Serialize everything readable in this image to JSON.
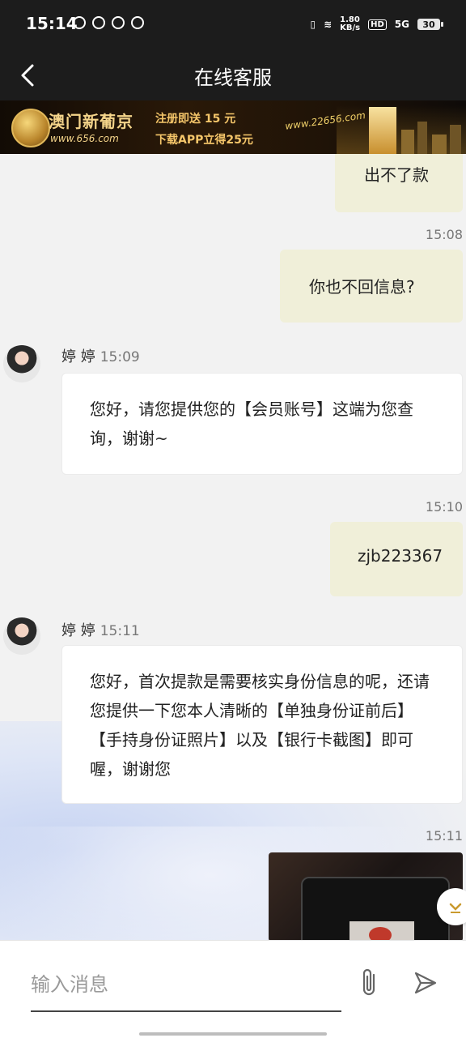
{
  "status_bar": {
    "time": "15:14",
    "network_speed": "1.80\nKB/s",
    "hd": "HD",
    "signal": "5G",
    "battery": "30"
  },
  "header": {
    "title": "在线客服"
  },
  "banner": {
    "brand": "澳门新葡京",
    "site": "www.656.com",
    "promo1": "注册即送 15 元",
    "promo2": "下载APP立得25元",
    "url": "www.22656.com"
  },
  "messages": [
    {
      "side": "right",
      "text": "出不了款",
      "time": ""
    },
    {
      "side": "right",
      "text": "你也不回信息?",
      "time": "15:08"
    },
    {
      "side": "left",
      "sender": "婷 婷",
      "time": "15:09",
      "text": "您好，请您提供您的【会员账号】这端为您查询，谢谢~"
    },
    {
      "side": "right",
      "text": "zjb223367",
      "time": "15:10"
    },
    {
      "side": "left",
      "sender": "婷 婷",
      "time": "15:11",
      "text": "您好，首次提款是需要核实身份信息的呢，还请您提供一下您本人清晰的【单独身份证前后】【手持身份证照片】以及【银行卡截图】即可喔，谢谢您"
    },
    {
      "side": "right",
      "type": "image",
      "time": "15:11"
    }
  ],
  "composer": {
    "placeholder": "输入消息"
  },
  "icons": {
    "back": "chevron-left-icon",
    "attach": "paperclip-icon",
    "send": "send-icon",
    "scroll": "chevron-down-icon"
  }
}
